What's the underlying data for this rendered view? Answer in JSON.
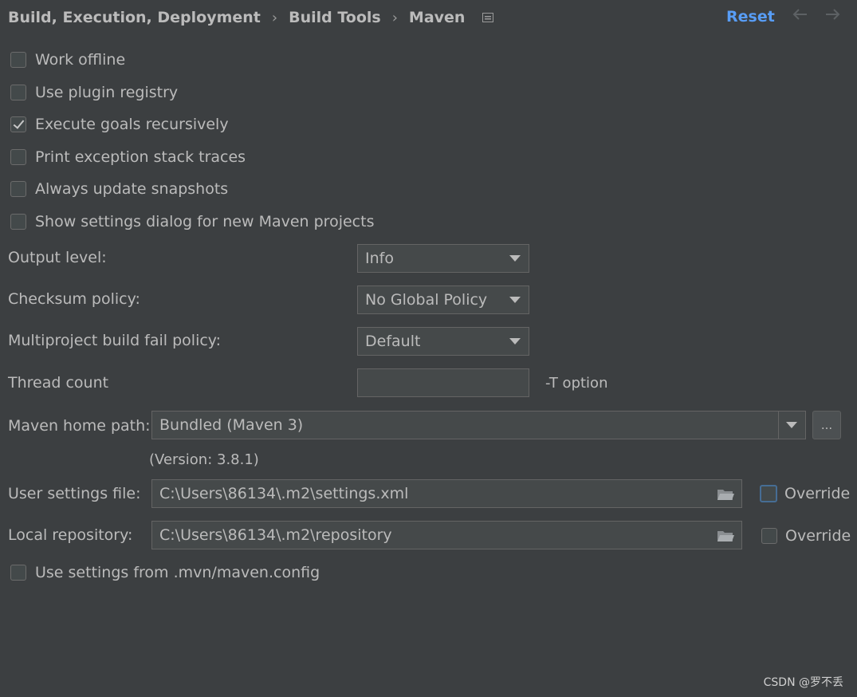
{
  "breadcrumb": {
    "items": [
      "Build, Execution, Deployment",
      "Build Tools",
      "Maven"
    ],
    "separator": "›"
  },
  "header": {
    "reset_label": "Reset",
    "back_icon": "arrow-left-icon",
    "forward_icon": "arrow-right-icon"
  },
  "options": [
    {
      "label": "Work offline",
      "checked": false
    },
    {
      "label": "Use plugin registry",
      "checked": false
    },
    {
      "label": "Execute goals recursively",
      "checked": true
    },
    {
      "label": "Print exception stack traces",
      "checked": false
    },
    {
      "label": "Always update snapshots",
      "checked": false
    },
    {
      "label": "Show settings dialog for new Maven projects",
      "checked": false
    }
  ],
  "output_level": {
    "label": "Output level:",
    "value": "Info"
  },
  "checksum_policy": {
    "label": "Checksum policy:",
    "value": "No Global Policy"
  },
  "fail_policy": {
    "label": "Multiproject build fail policy:",
    "value": "Default"
  },
  "thread_count": {
    "label": "Thread count",
    "value": "",
    "hint": "-T option"
  },
  "maven_home": {
    "label": "Maven home path:",
    "value": "Bundled (Maven 3)",
    "browse_label": "...",
    "version": "(Version: 3.8.1)"
  },
  "user_settings": {
    "label": "User settings file:",
    "value": "C:\\Users\\86134\\.m2\\settings.xml",
    "override_label": "Override",
    "override_checked": false
  },
  "local_repo": {
    "label": "Local repository:",
    "value": "C:\\Users\\86134\\.m2\\repository",
    "override_label": "Override",
    "override_checked": false
  },
  "mvn_config": {
    "label": "Use settings from .mvn/maven.config",
    "checked": false
  },
  "watermark": "CSDN @罗不丢",
  "colors": {
    "background": "#3c3f41",
    "text": "#bbbbbb",
    "link": "#589df6",
    "focus": "#466d94"
  }
}
